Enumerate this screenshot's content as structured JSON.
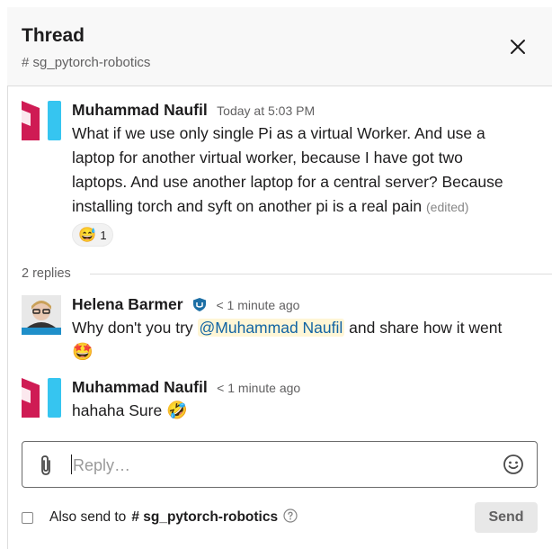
{
  "header": {
    "title": "Thread",
    "channel": "# sg_pytorch-robotics"
  },
  "parent_message": {
    "author": "Muhammad Naufil",
    "time": "Today at 5:03 PM",
    "text": "What if we use only single Pi as a virtual Worker. And use a laptop for another virtual worker, because I have got two laptops. And use another laptop for a central server? Because installing torch and syft on another pi is a real pain",
    "edited": "(edited)",
    "reaction": {
      "emoji": "😅",
      "count": "1"
    }
  },
  "replies_label": "2 replies",
  "replies": [
    {
      "author": "Helena Barmer",
      "time": "< 1 minute ago",
      "text_before": "Why don't you try ",
      "mention": "@Muhammad Naufil",
      "text_after": " and share how it went",
      "emoji": "🤩"
    },
    {
      "author": "Muhammad Naufil",
      "time": "< 1 minute ago",
      "text": "hahaha Sure",
      "emoji": "🤣"
    }
  ],
  "composer": {
    "placeholder": "Reply…"
  },
  "footer": {
    "also_send_label": "Also send to",
    "channel": "# sg_pytorch-robotics",
    "send_label": "Send"
  },
  "colors": {
    "avatar_red": "#cf1b54",
    "avatar_blue": "#36c5f0",
    "mention_bg": "#fff6d6",
    "mention_text": "#1264a3"
  }
}
